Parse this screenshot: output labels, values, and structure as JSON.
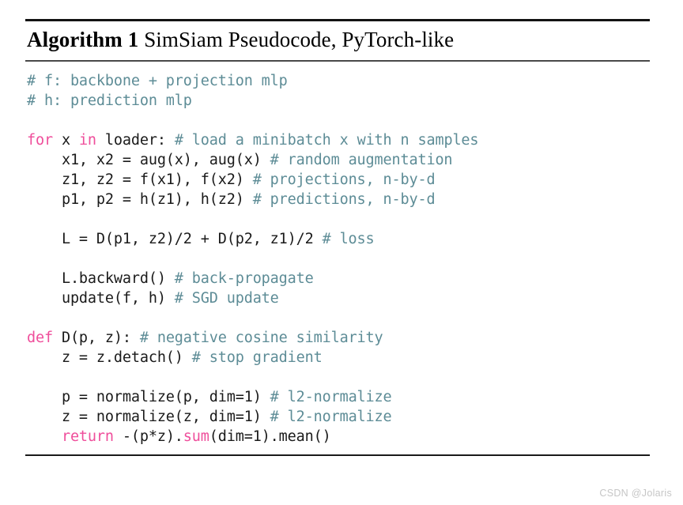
{
  "algorithm": {
    "label": "Algorithm 1",
    "caption": " SimSiam Pseudocode, PyTorch-like",
    "title_full": "Algorithm 1 SimSiam Pseudocode, PyTorch-like",
    "colors": {
      "keyword": "#ef4e9b",
      "comment": "#5d8c96",
      "plain": "#1a1a1a",
      "rule": "#131313",
      "background": "#ffffff",
      "watermark": "#c6c6c6"
    },
    "code_lines": [
      {
        "id": "line-1",
        "indent": 0,
        "tokens": [
          {
            "t": "cmt",
            "s": "# f: backbone + projection mlp"
          }
        ]
      },
      {
        "id": "line-2",
        "indent": 0,
        "tokens": [
          {
            "t": "cmt",
            "s": "# h: prediction mlp"
          }
        ]
      },
      {
        "id": "line-3",
        "indent": 0,
        "blank": true,
        "tokens": []
      },
      {
        "id": "line-4",
        "indent": 0,
        "tokens": [
          {
            "t": "kw",
            "s": "for"
          },
          {
            "t": "plain",
            "s": " x "
          },
          {
            "t": "kw",
            "s": "in"
          },
          {
            "t": "plain",
            "s": " loader: "
          },
          {
            "t": "cmt",
            "s": "# load a minibatch x with n samples"
          }
        ]
      },
      {
        "id": "line-5",
        "indent": 1,
        "tokens": [
          {
            "t": "plain",
            "s": "x1, x2 = aug(x), aug(x) "
          },
          {
            "t": "cmt",
            "s": "# random augmentation"
          }
        ]
      },
      {
        "id": "line-6",
        "indent": 1,
        "tokens": [
          {
            "t": "plain",
            "s": "z1, z2 = f(x1), f(x2) "
          },
          {
            "t": "cmt",
            "s": "# projections, n-by-d"
          }
        ]
      },
      {
        "id": "line-7",
        "indent": 1,
        "tokens": [
          {
            "t": "plain",
            "s": "p1, p2 = h(z1), h(z2) "
          },
          {
            "t": "cmt",
            "s": "# predictions, n-by-d"
          }
        ]
      },
      {
        "id": "line-8",
        "indent": 0,
        "blank": true,
        "tokens": []
      },
      {
        "id": "line-9",
        "indent": 1,
        "tokens": [
          {
            "t": "plain",
            "s": "L = D(p1, z2)/2 + D(p2, z1)/2 "
          },
          {
            "t": "cmt",
            "s": "# loss"
          }
        ]
      },
      {
        "id": "line-10",
        "indent": 0,
        "blank": true,
        "tokens": []
      },
      {
        "id": "line-11",
        "indent": 1,
        "tokens": [
          {
            "t": "plain",
            "s": "L.backward() "
          },
          {
            "t": "cmt",
            "s": "# back-propagate"
          }
        ]
      },
      {
        "id": "line-12",
        "indent": 1,
        "tokens": [
          {
            "t": "plain",
            "s": "update(f, h) "
          },
          {
            "t": "cmt",
            "s": "# SGD update"
          }
        ]
      },
      {
        "id": "line-13",
        "indent": 0,
        "blank": true,
        "tokens": []
      },
      {
        "id": "line-14",
        "indent": 0,
        "tokens": [
          {
            "t": "kw",
            "s": "def"
          },
          {
            "t": "plain",
            "s": " D(p, z): "
          },
          {
            "t": "cmt",
            "s": "# negative cosine similarity"
          }
        ]
      },
      {
        "id": "line-15",
        "indent": 1,
        "tokens": [
          {
            "t": "plain",
            "s": "z = z.detach() "
          },
          {
            "t": "cmt",
            "s": "# stop gradient"
          }
        ]
      },
      {
        "id": "line-16",
        "indent": 0,
        "blank": true,
        "tokens": []
      },
      {
        "id": "line-17",
        "indent": 1,
        "tokens": [
          {
            "t": "plain",
            "s": "p = normalize(p, dim=1) "
          },
          {
            "t": "cmt",
            "s": "# l2-normalize"
          }
        ]
      },
      {
        "id": "line-18",
        "indent": 1,
        "tokens": [
          {
            "t": "plain",
            "s": "z = normalize(z, dim=1) "
          },
          {
            "t": "cmt",
            "s": "# l2-normalize"
          }
        ]
      },
      {
        "id": "line-19",
        "indent": 1,
        "tokens": [
          {
            "t": "kw",
            "s": "return"
          },
          {
            "t": "plain",
            "s": " -(p*z)."
          },
          {
            "t": "kw",
            "s": "sum"
          },
          {
            "t": "plain",
            "s": "(dim=1).mean()"
          }
        ]
      }
    ]
  },
  "watermark": {
    "text": "CSDN @Jolaris"
  }
}
